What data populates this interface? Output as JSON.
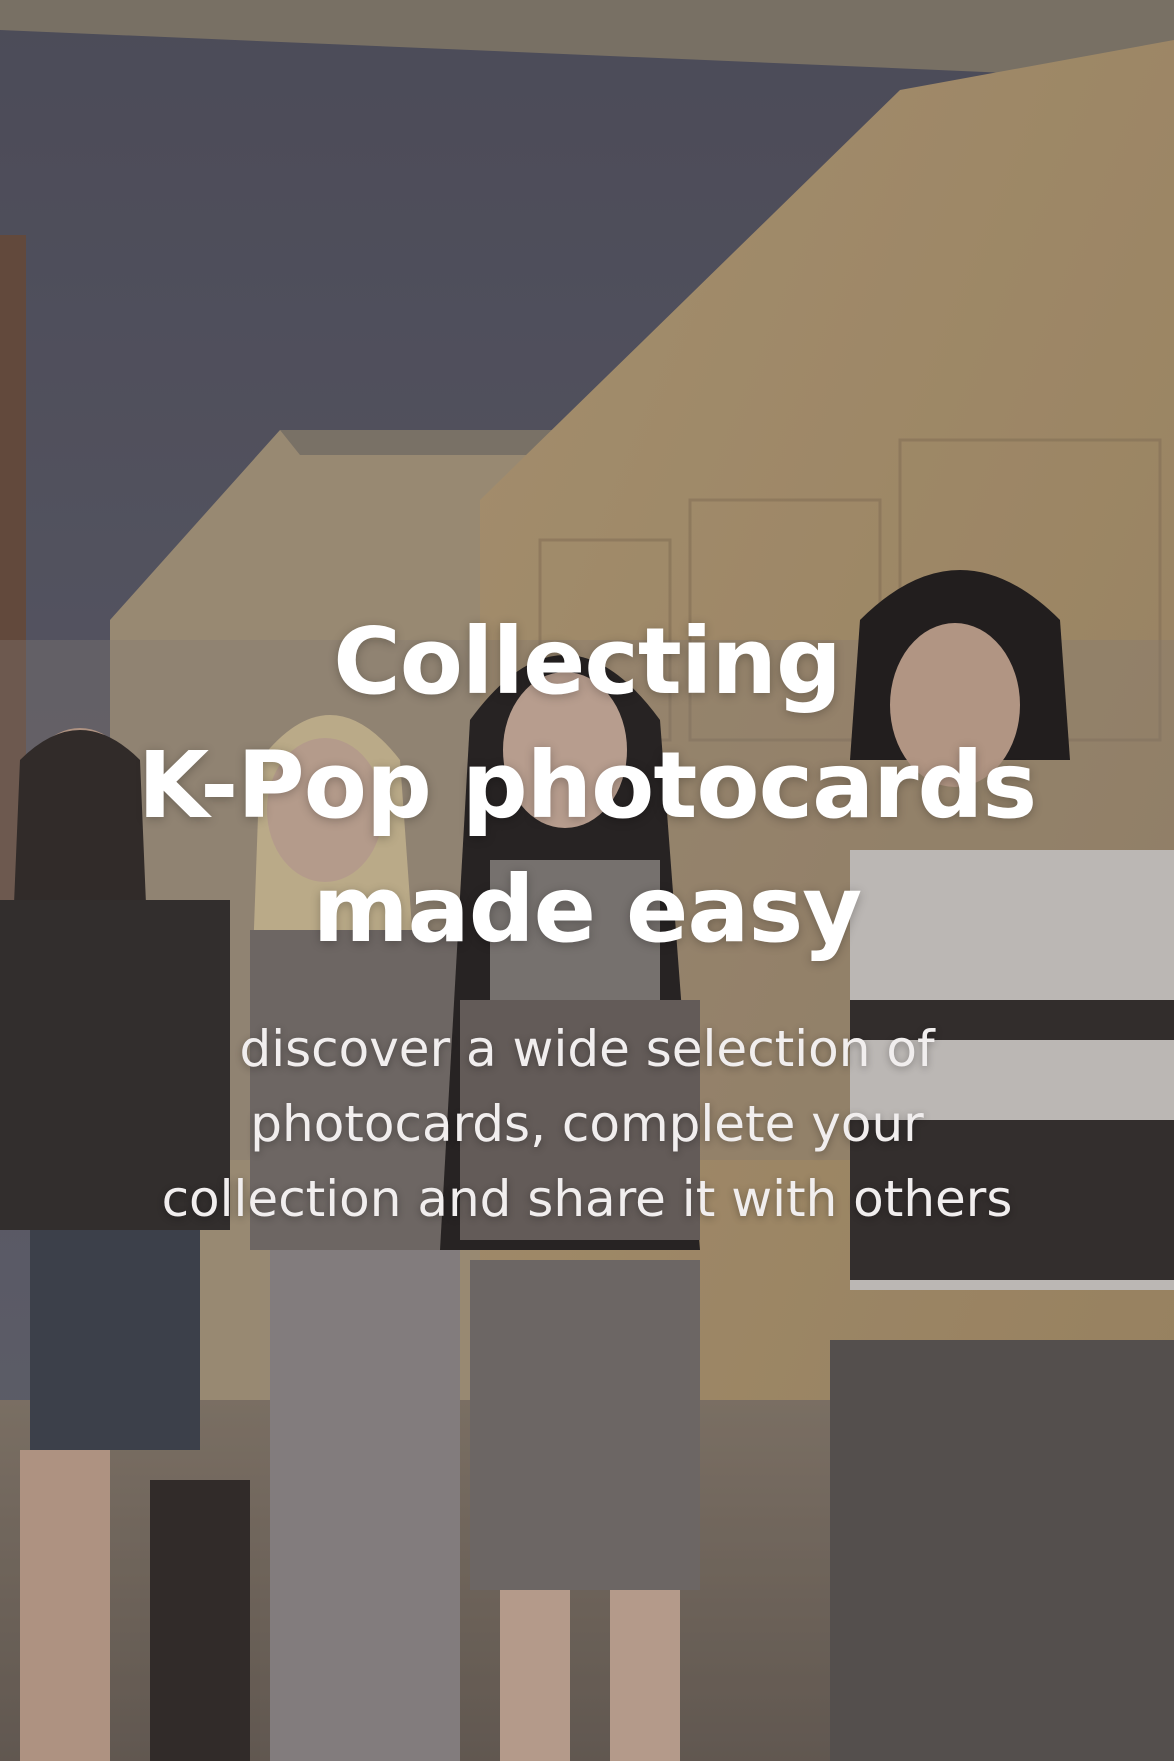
{
  "background": {
    "image": "kpop-group-photo",
    "sky_color": "#575b6d",
    "wall_color": "#c9b184",
    "overlay_color": "#463c3c"
  },
  "hero": {
    "headline_lines": [
      "Collecting",
      "K-Pop photocards",
      "made easy"
    ],
    "subtitle_lines": [
      "discover a wide selection of",
      "photocards, complete your",
      "collection and share it with others"
    ]
  }
}
